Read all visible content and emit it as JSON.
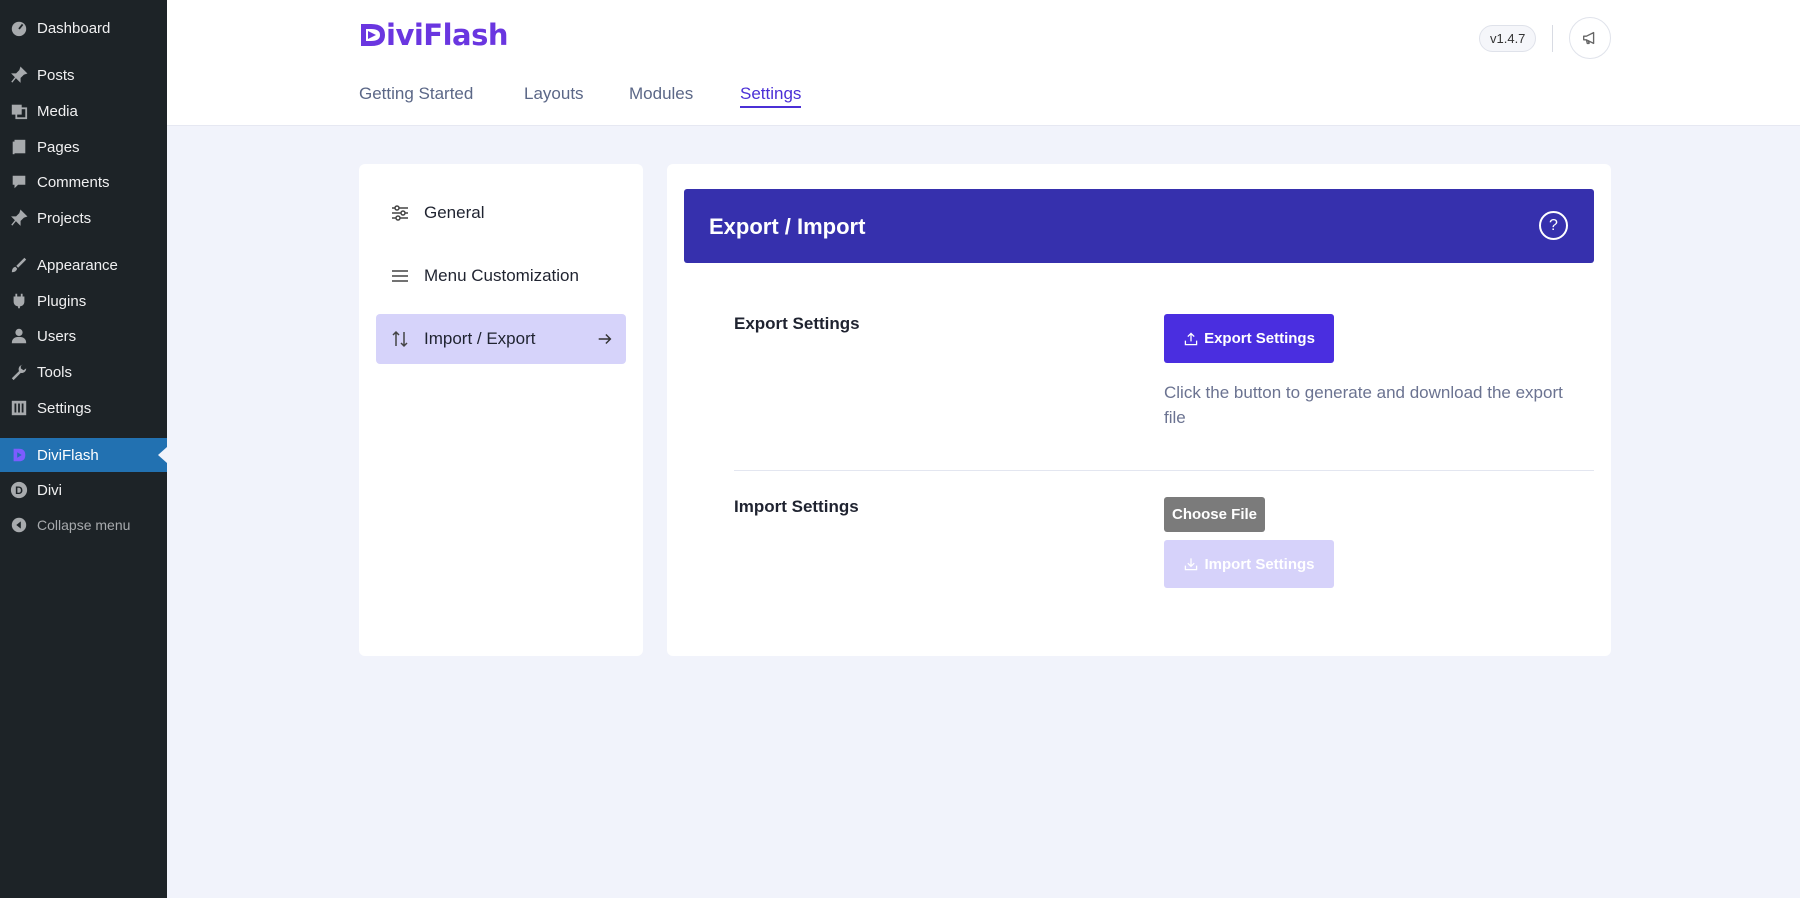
{
  "wp_menu": {
    "items": [
      {
        "label": "Dashboard",
        "icon": "dashboard-icon"
      },
      {
        "label": "Posts",
        "icon": "pin-icon"
      },
      {
        "label": "Media",
        "icon": "media-icon"
      },
      {
        "label": "Pages",
        "icon": "pages-icon"
      },
      {
        "label": "Comments",
        "icon": "comment-icon"
      },
      {
        "label": "Projects",
        "icon": "pin-icon"
      },
      {
        "label": "Appearance",
        "icon": "brush-icon"
      },
      {
        "label": "Plugins",
        "icon": "plugin-icon"
      },
      {
        "label": "Users",
        "icon": "user-icon"
      },
      {
        "label": "Tools",
        "icon": "wrench-icon"
      },
      {
        "label": "Settings",
        "icon": "settings-icon"
      },
      {
        "label": "DiviFlash",
        "icon": "diviflash-icon",
        "active": true
      },
      {
        "label": "Divi",
        "icon": "divi-icon"
      },
      {
        "label": "Collapse menu",
        "icon": "collapse-icon"
      }
    ]
  },
  "header": {
    "logo_text": "iviFlash",
    "version": "v1.4.7",
    "tabs": [
      {
        "label": "Getting Started"
      },
      {
        "label": "Layouts"
      },
      {
        "label": "Modules"
      },
      {
        "label": "Settings",
        "active": true
      }
    ]
  },
  "settings_nav": {
    "items": [
      {
        "label": "General",
        "icon": "sliders-icon"
      },
      {
        "label": "Menu Customization",
        "icon": "menu-icon"
      },
      {
        "label": "Import / Export",
        "icon": "import-export-icon",
        "active": true
      }
    ]
  },
  "panel": {
    "title": "Export / Import",
    "help": "?",
    "export": {
      "label": "Export Settings",
      "button": "Export Settings",
      "description": "Click the button to generate and download the export file"
    },
    "import": {
      "label": "Import Settings",
      "choose_file": "Choose File",
      "button": "Import Settings"
    }
  },
  "colors": {
    "wp_sidebar": "#1d2327",
    "wp_active": "#2271b1",
    "brand": "#4a2ee0",
    "panel_header": "#3630ad",
    "nav_active_bg": "#d6d3fa"
  }
}
